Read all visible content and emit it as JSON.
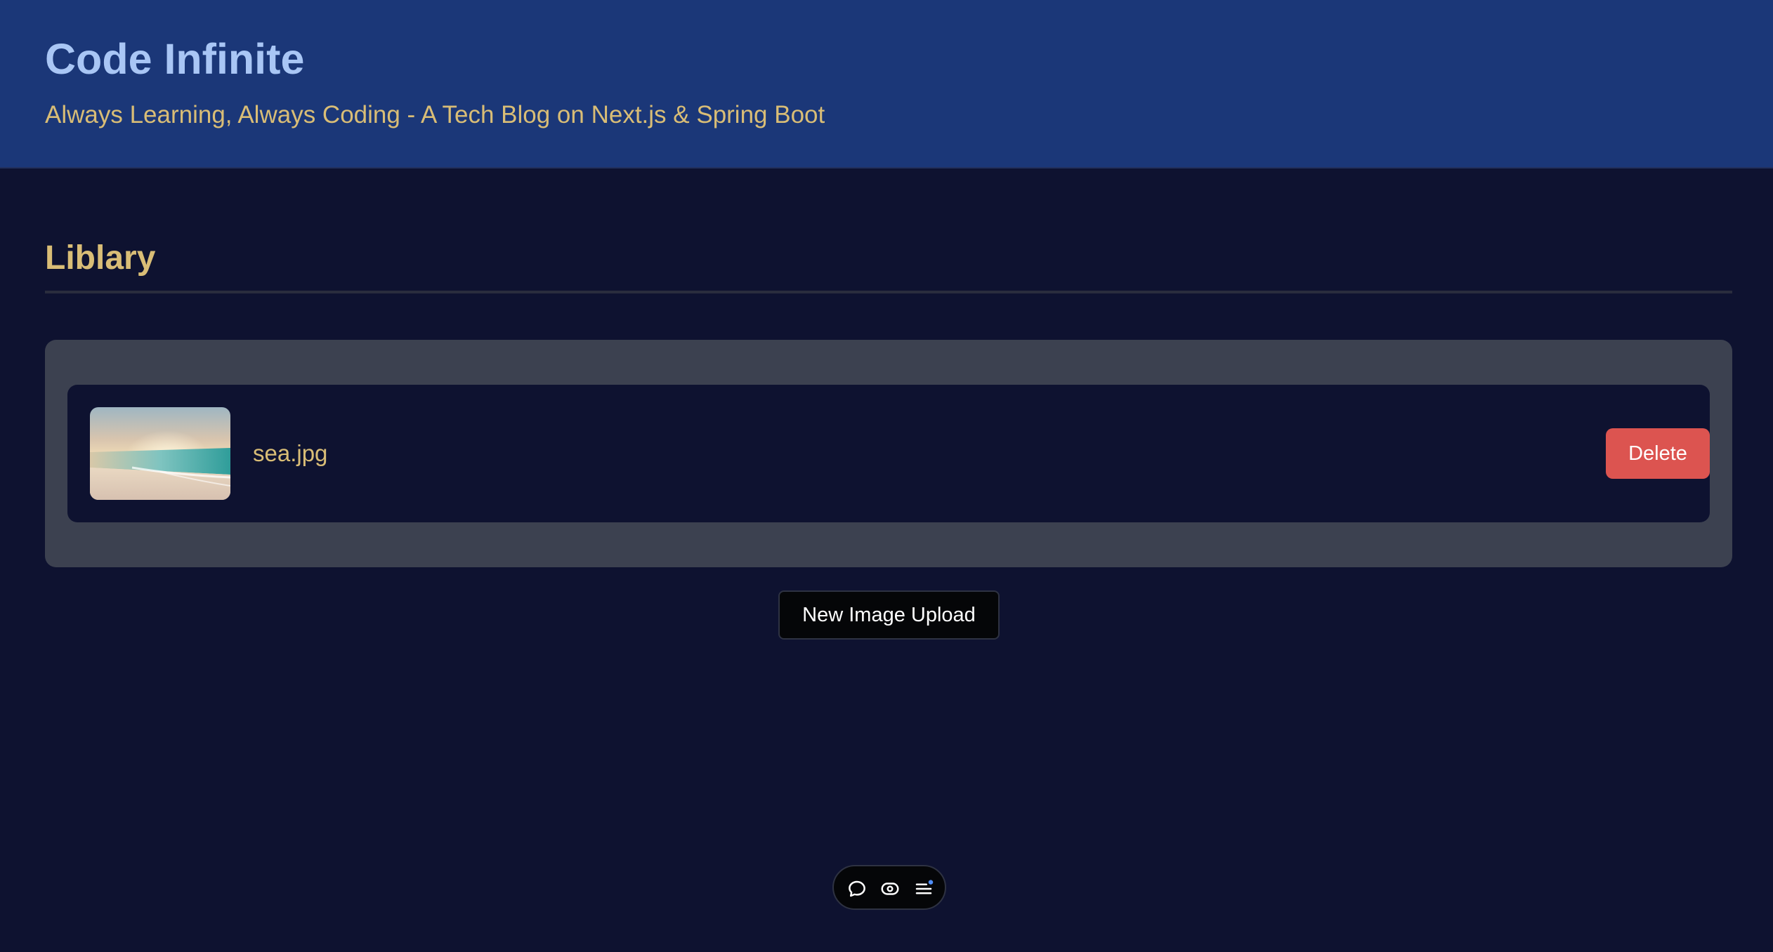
{
  "header": {
    "title": "Code Infinite",
    "tagline": "Always Learning, Always Coding - A Tech Blog on Next.js & Spring Boot"
  },
  "library": {
    "title": "Liblary",
    "items": [
      {
        "file_name": "sea.jpg",
        "thumbnail": "sea-beach-thumbnail",
        "delete_label": "Delete"
      }
    ],
    "upload_label": "New Image Upload"
  },
  "toolbar": {
    "icons": [
      "chat-bubble-icon",
      "eye-icon",
      "menu-icon"
    ],
    "notification_dot_color": "#4f8df7"
  },
  "colors": {
    "header_bg": "#1b3778",
    "page_bg": "#0e1230",
    "title": "#a9c6f5",
    "accent_gold": "#d9bd76",
    "panel_bg": "#3c4150",
    "delete_red": "#dc5450"
  }
}
